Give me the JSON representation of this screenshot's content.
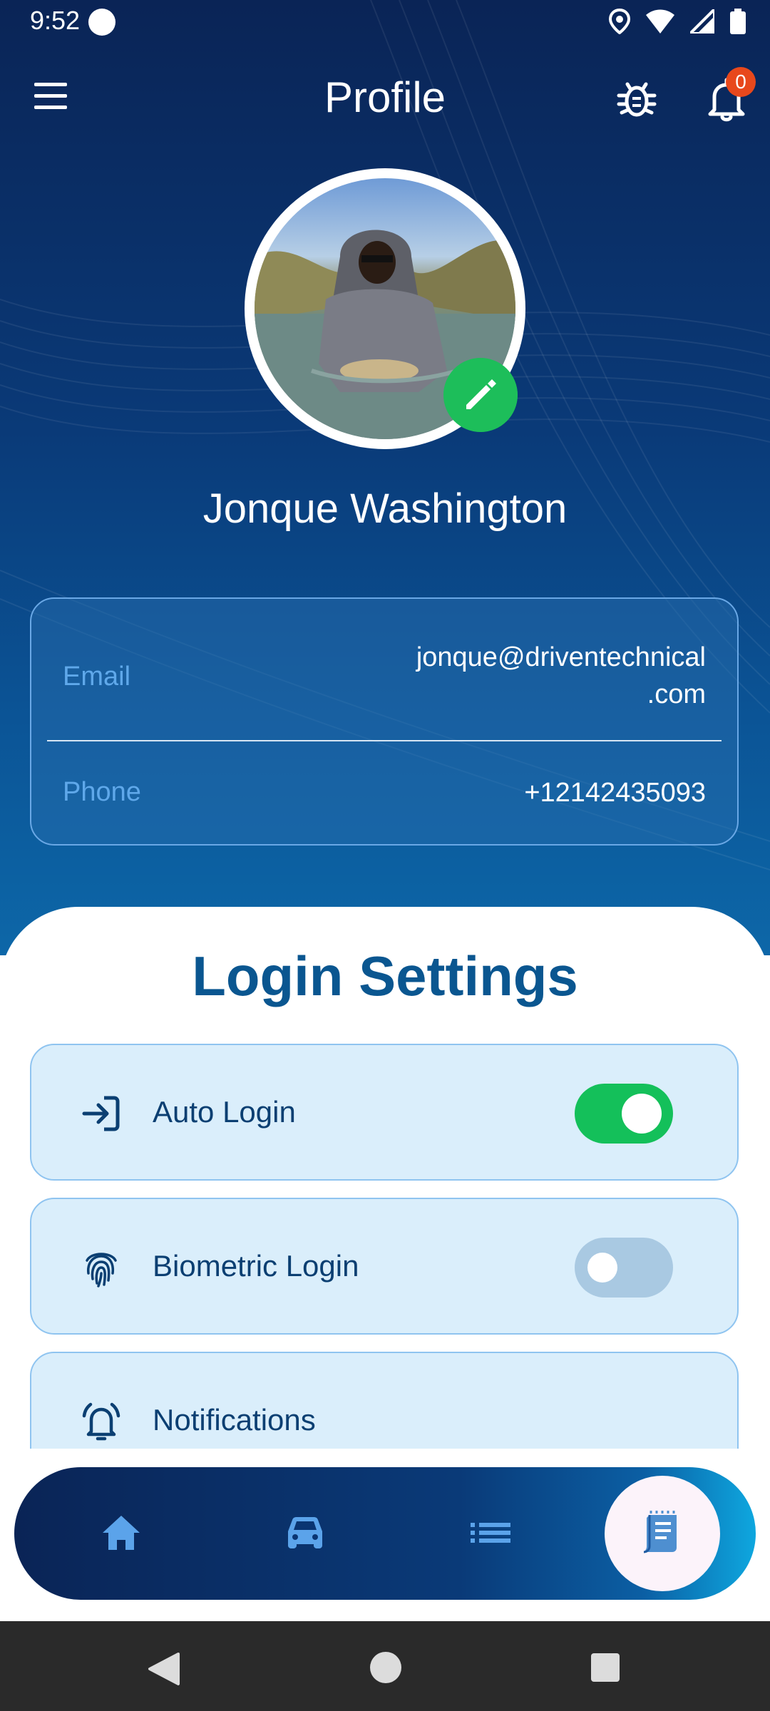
{
  "status_bar": {
    "time": "9:52"
  },
  "header": {
    "title": "Profile",
    "notification_count": "0"
  },
  "profile": {
    "name": "Jonque Washington",
    "email_label": "Email",
    "email_line1": "jonque@driventechnical",
    "email_line2": ".com",
    "phone_label": "Phone",
    "phone_value": "+12142435093"
  },
  "login_settings": {
    "title": "Login Settings",
    "items": [
      {
        "label": "Auto Login",
        "icon": "login-arrow-icon",
        "enabled": true
      },
      {
        "label": "Biometric Login",
        "icon": "fingerprint-icon",
        "enabled": false
      },
      {
        "label": "Notifications",
        "icon": "bell-ring-icon"
      }
    ]
  },
  "bottom_nav": {
    "items": [
      "home-icon",
      "car-icon",
      "list-icon",
      "document-icon"
    ],
    "active": "document-icon"
  },
  "colors": {
    "accent_green": "#1dbe5a",
    "badge": "#e8481c",
    "heading_blue": "#0a5690",
    "toggle_off": "#a9c9e2"
  }
}
